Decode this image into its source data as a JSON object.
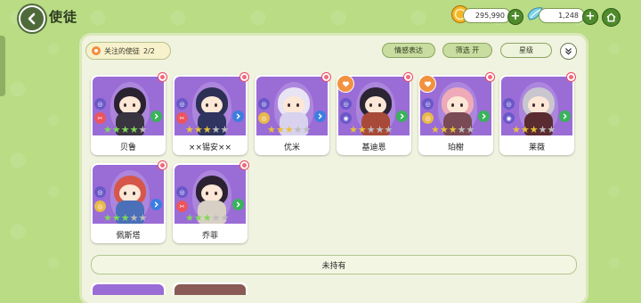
{
  "header": {
    "title": "使徒",
    "currency_primary": "295,990",
    "currency_secondary": "1,248"
  },
  "filters": {
    "focus_label": "关注的使徒",
    "focus_count": "2/2",
    "emotion_label": "情感表达",
    "filter_label": "筛选 开",
    "star_label": "星级"
  },
  "owned": [
    {
      "name": "贝鲁",
      "stars": 5,
      "filled": 4,
      "star_color": "#7ed957",
      "hair": "#2a2230",
      "outfit": "#3a3340",
      "elem": "#ea5560",
      "elem_glyph": "✂",
      "arrow": "#38b35a",
      "fav": false
    },
    {
      "name": "××锡安××",
      "stars": 5,
      "filled": 3,
      "star_color": "#e8c23a",
      "hair": "#2d2f55",
      "outfit": "#2f3560",
      "elem": "#ea5560",
      "elem_glyph": "✂",
      "arrow": "#3b7ee0",
      "fav": false
    },
    {
      "name": "优米",
      "stars": 5,
      "filled": 3,
      "star_color": "#e8c23a",
      "hair": "#e9e4f3",
      "outfit": "#d8d2ee",
      "elem": "#e8b84a",
      "elem_glyph": "◎",
      "arrow": "#3b7ee0",
      "fav": false
    },
    {
      "name": "基迪恩",
      "stars": 5,
      "filled": 2,
      "star_color": "#e8c23a",
      "hair": "#2a2433",
      "outfit": "#a84a3a",
      "elem": "#6a58c9",
      "elem_glyph": "◉",
      "arrow": "#38b35a",
      "fav": true
    },
    {
      "name": "珀榭",
      "stars": 5,
      "filled": 3,
      "star_color": "#e8c23a",
      "hair": "#eeaab8",
      "outfit": "#7a4a55",
      "elem": "#e8b84a",
      "elem_glyph": "◎",
      "arrow": "#38b35a",
      "fav": true
    },
    {
      "name": "莱薇",
      "stars": 5,
      "filled": 3,
      "star_color": "#e8c23a",
      "hair": "#c9c6cf",
      "outfit": "#5a2b30",
      "elem": "#6a58c9",
      "elem_glyph": "◉",
      "arrow": "#38b35a",
      "fav": false
    },
    {
      "name": "佩斯塔",
      "stars": 5,
      "filled": 3,
      "star_color": "#7ed957",
      "hair": "#d6574a",
      "outfit": "#4b6fb8",
      "elem": "#e8b84a",
      "elem_glyph": "◎",
      "arrow": "#3b7ee0",
      "fav": false
    },
    {
      "name": "乔菲",
      "stars": 5,
      "filled": 3,
      "star_color": "#7ed957",
      "hair": "#2a2230",
      "outfit": "#d8d0c4",
      "elem": "#ea5560",
      "elem_glyph": "✂",
      "arrow": "#38b35a",
      "fav": false
    }
  ],
  "unowned_label": "未持有",
  "colors": {
    "background": "#b9dc84",
    "panel": "#f0f3df",
    "portrait": "#9a6cd6",
    "accent_green": "#4f8a2c"
  }
}
